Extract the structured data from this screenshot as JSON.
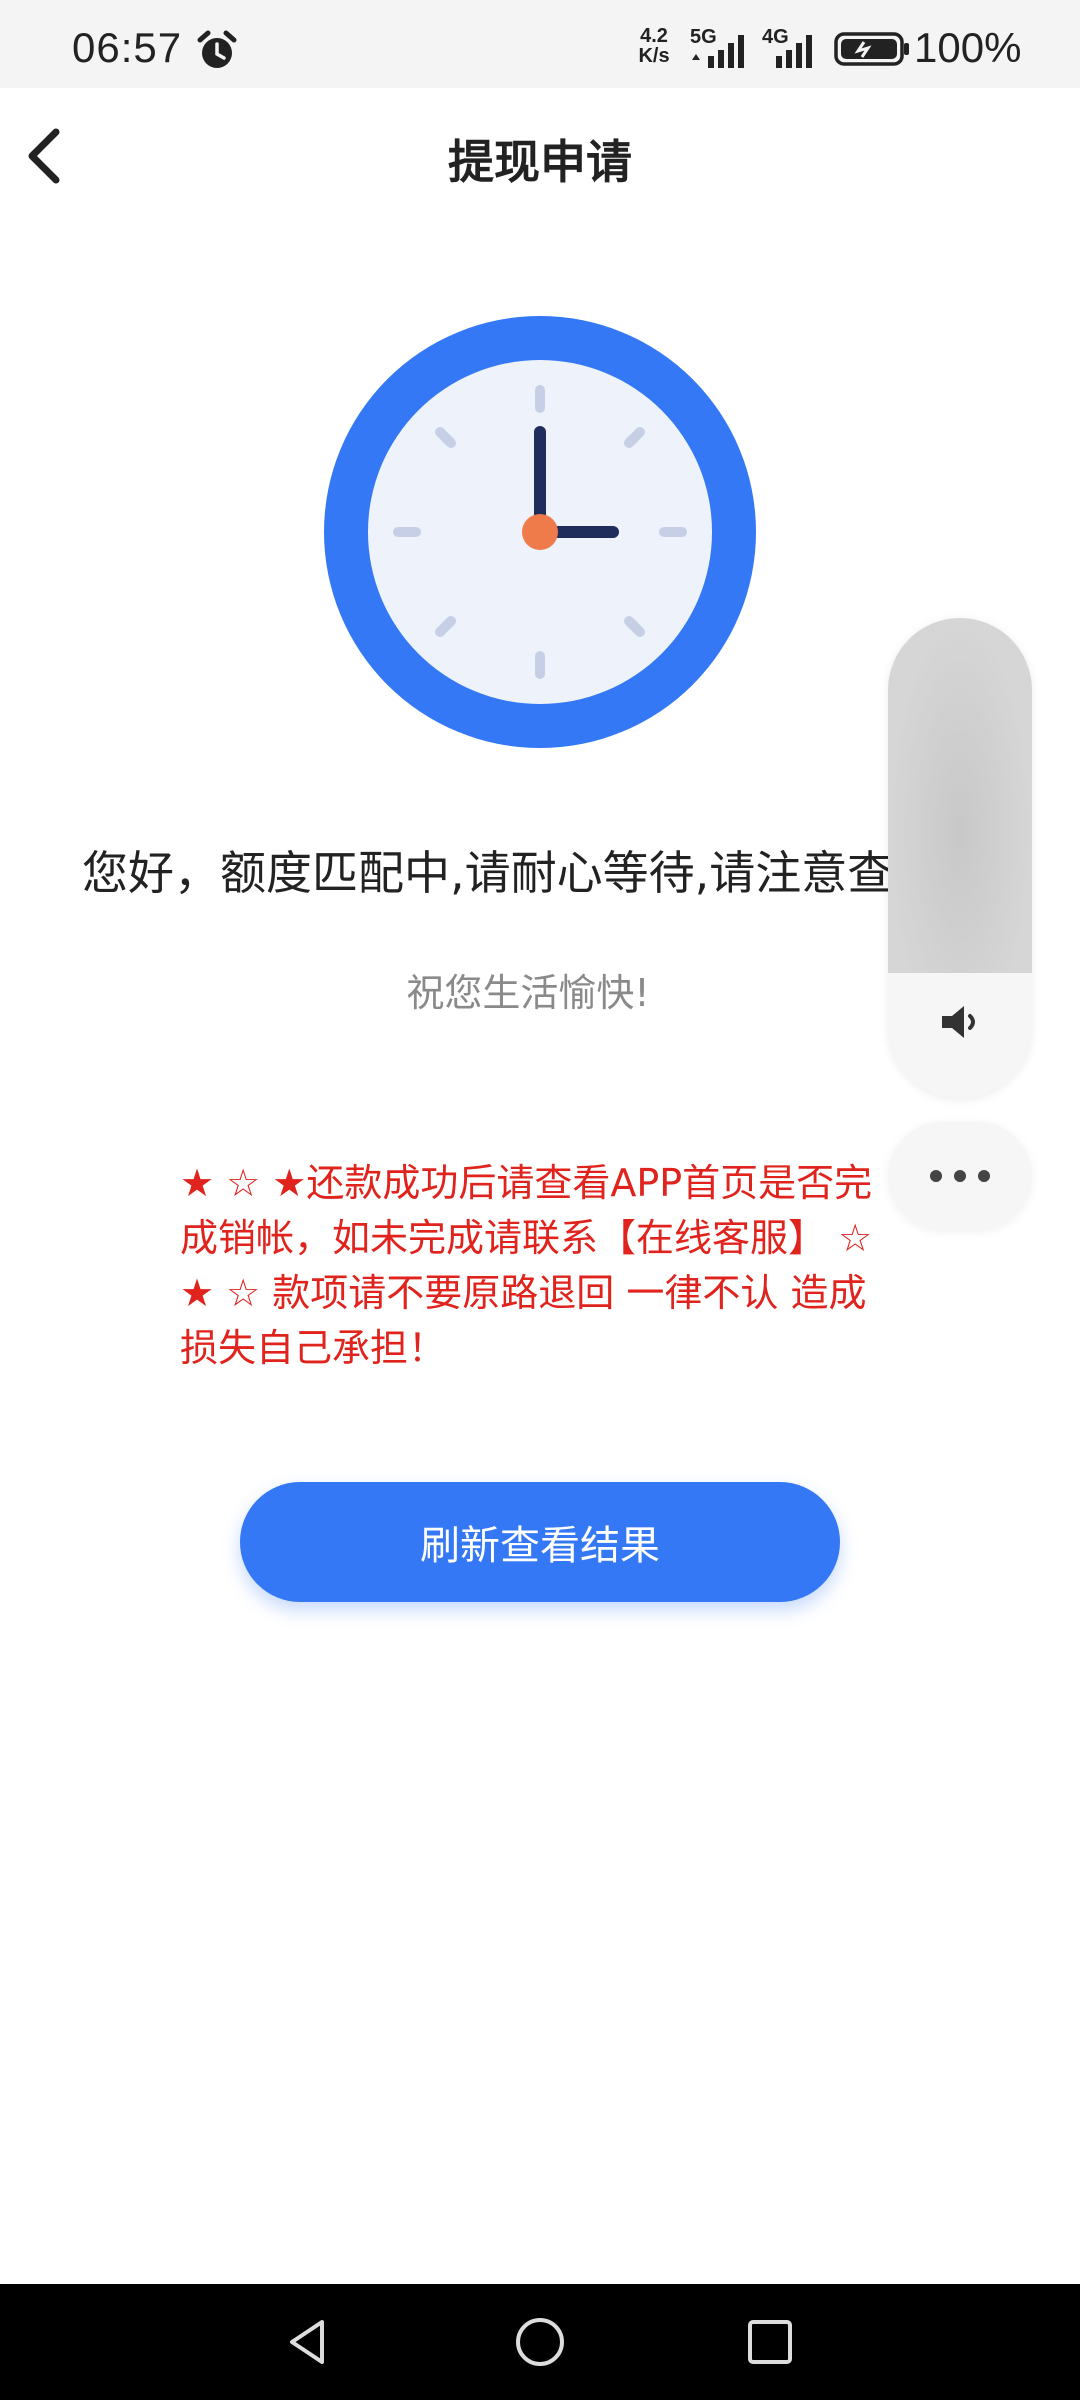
{
  "status_bar": {
    "time": "06:57",
    "speed_value": "4.2",
    "speed_unit": "K/s",
    "network_5g": "5G",
    "network_4g": "4G",
    "battery": "100%"
  },
  "header": {
    "title": "提现申请"
  },
  "main": {
    "notice": "您好，额度匹配中,请耐心等待,请注意查",
    "greeting": "祝您生活愉快!",
    "warning": " ★ ☆ ★还款成功后请查看APP首页是否完成销帐，如未完成请联系【在线客服】 ☆ ★ ☆ 款项请不要原路退回 一律不认 造成损失自己承担！",
    "refresh_label": "刷新查看结果"
  },
  "volume_panel": {
    "level": 0.74
  },
  "colors": {
    "accent": "#3478f6",
    "warning": "#e0231c",
    "clock_face": "#eef2fa",
    "clock_hand": "#1f2d5c",
    "clock_center": "#ef7a4a"
  },
  "icons": {
    "back": "chevron-left-icon",
    "alarm": "alarm-clock-icon",
    "volume": "speaker-icon",
    "more": "ellipsis-icon",
    "nav": [
      "back-triangle-icon",
      "home-circle-icon",
      "recents-square-icon"
    ]
  }
}
